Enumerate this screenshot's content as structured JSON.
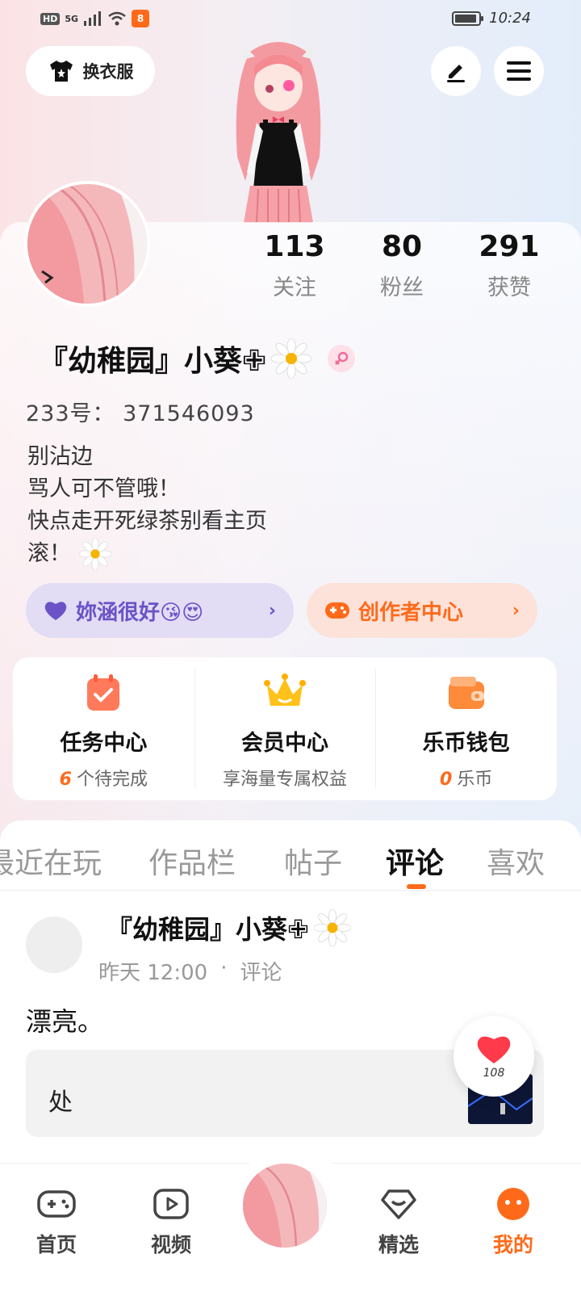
{
  "status_bar": {
    "hd": "HD",
    "network": "5G",
    "time": "10:24"
  },
  "header": {
    "dress_label": "换衣服"
  },
  "stats": [
    {
      "num": "113",
      "label": "关注"
    },
    {
      "num": "80",
      "label": "粉丝"
    },
    {
      "num": "291",
      "label": "获赞"
    }
  ],
  "profile": {
    "nickname": "『幼稚园』小葵✙",
    "uid": "233号： 371546093",
    "bio": [
      "别沾边",
      "骂人可不管哦！",
      "快点走开死绿茶别看主页",
      "滚！"
    ]
  },
  "pills": {
    "left_label": "妳涵很好😘😍",
    "right_label": "创作者中心"
  },
  "features": [
    {
      "title": "任务中心",
      "accent": "6",
      "sub": "个待完成"
    },
    {
      "title": "会员中心",
      "accent": "",
      "sub": "享海量专属权益"
    },
    {
      "title": "乐币钱包",
      "accent": "0",
      "sub": "乐币"
    }
  ],
  "tabs": [
    "最近在玩",
    "作品栏",
    "帖子",
    "评论",
    "喜欢"
  ],
  "active_tab": "评论",
  "post": {
    "author": "『幼稚园』小葵✙",
    "time": "昨天 12:00",
    "dot": "·",
    "type": "评论",
    "text": "漂亮。",
    "quote": "处",
    "likes": "108"
  },
  "bottom_nav": {
    "home": "首页",
    "video": "视频",
    "featured": "精选",
    "mine": "我的"
  },
  "colors": {
    "accent": "#ff6a1a",
    "purple": "#6b52c7",
    "pink": "#f3a3a8"
  }
}
